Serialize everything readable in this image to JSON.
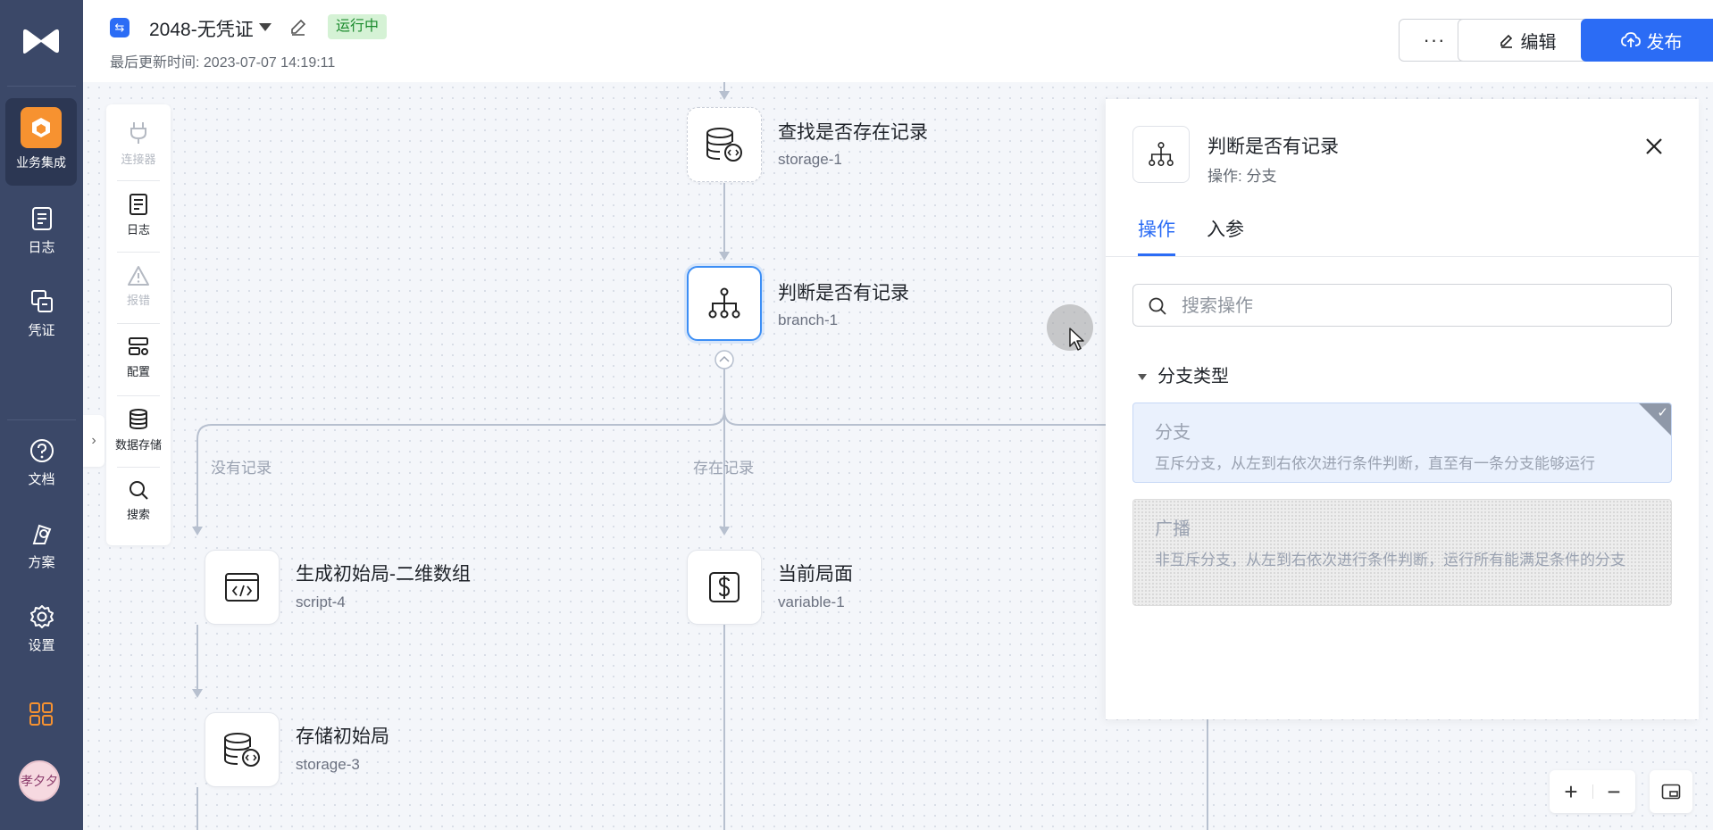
{
  "sidebar": {
    "items": [
      {
        "label": "业务集成",
        "icon": "cube-icon"
      },
      {
        "label": "日志",
        "icon": "log-icon"
      },
      {
        "label": "凭证",
        "icon": "credential-icon"
      },
      {
        "label": "文档",
        "icon": "help-icon"
      },
      {
        "label": "方案",
        "icon": "solution-icon"
      },
      {
        "label": "设置",
        "icon": "gear-icon"
      }
    ],
    "avatar_text": "孝夕夕"
  },
  "header": {
    "title": "2048-无凭证",
    "status": "运行中",
    "updated": "最后更新时间: 2023-07-07 14:19:11",
    "more_label": "···",
    "edit_label": "编辑",
    "publish_label": "发布"
  },
  "tools": [
    {
      "label": "连接器",
      "disabled": true
    },
    {
      "label": "日志",
      "disabled": false
    },
    {
      "label": "报错",
      "disabled": true
    },
    {
      "label": "配置",
      "disabled": false
    },
    {
      "label": "数据存储",
      "disabled": false
    },
    {
      "label": "搜索",
      "disabled": false
    }
  ],
  "flow": {
    "nodes": [
      {
        "title": "查找是否存在记录",
        "id": "storage-1"
      },
      {
        "title": "判断是否有记录",
        "id": "branch-1"
      },
      {
        "title": "生成初始局-二维数组",
        "id": "script-4"
      },
      {
        "title": "当前局面",
        "id": "variable-1"
      },
      {
        "title": "存储初始局",
        "id": "storage-3"
      }
    ],
    "edges": [
      "没有记录",
      "存在记录"
    ]
  },
  "panel": {
    "title": "判断是否有记录",
    "subtitle": "操作: 分支",
    "tabs": [
      "操作",
      "入参"
    ],
    "search_placeholder": "搜索操作",
    "group": "分支类型",
    "options": [
      {
        "title": "分支",
        "desc": "互斥分支，从左到右依次进行条件判断，直至有一条分支能够运行",
        "selected": true
      },
      {
        "title": "广播",
        "desc": "非互斥分支，从左到右依次进行条件判断，运行所有能满足条件的分支",
        "selected": false
      }
    ]
  },
  "zoom": {
    "in": "+",
    "out": "−"
  },
  "colors": {
    "accent": "#2b6cf5",
    "sidebar": "#3b4868",
    "status_bg": "#d5f2d5",
    "status_fg": "#1a8a2c",
    "selected_node": "#3c8ef5"
  }
}
